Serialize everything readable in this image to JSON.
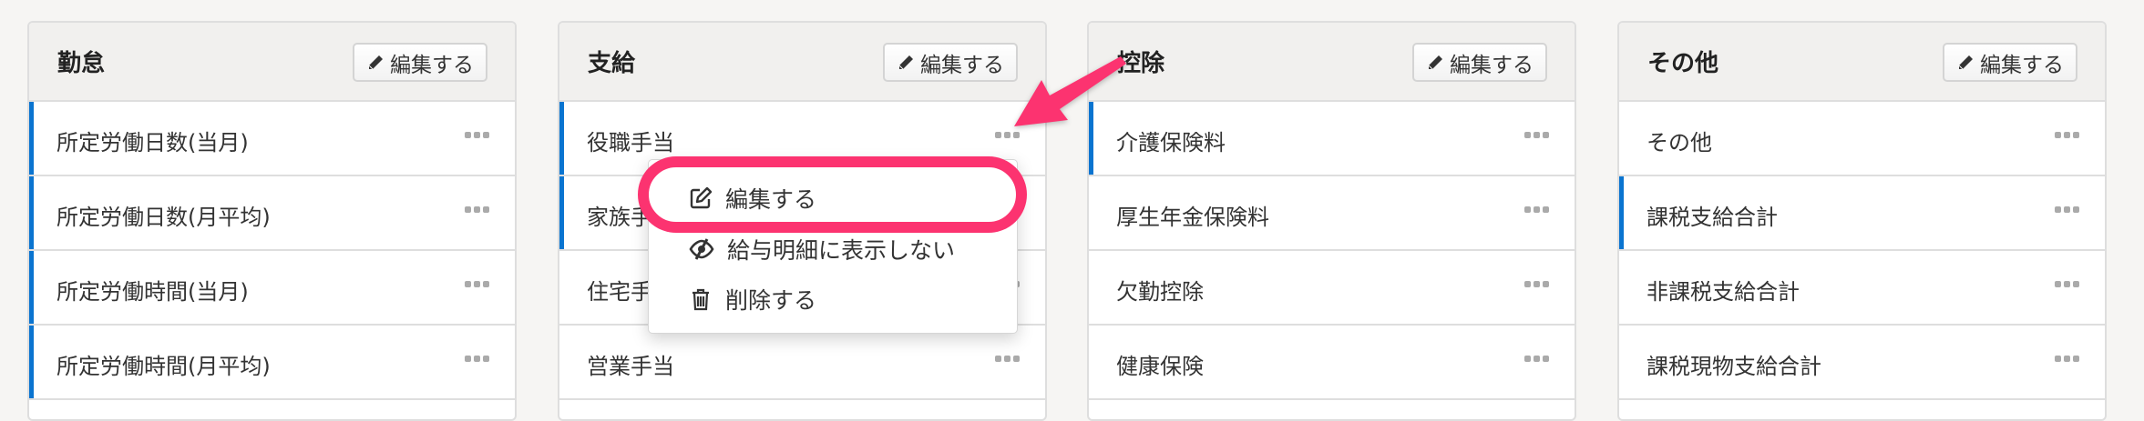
{
  "columns": [
    {
      "title": "勤怠",
      "edit_label": "編集する",
      "items": [
        {
          "label": "所定労働日数(当月)",
          "marked": true
        },
        {
          "label": "所定労働日数(月平均)",
          "marked": true
        },
        {
          "label": "所定労働時間(当月)",
          "marked": true
        },
        {
          "label": "所定労働時間(月平均)",
          "marked": true
        }
      ]
    },
    {
      "title": "支給",
      "edit_label": "編集する",
      "items": [
        {
          "label": "役職手当",
          "marked": true
        },
        {
          "label": "家族手当",
          "marked": true
        },
        {
          "label": "住宅手当",
          "marked": false
        },
        {
          "label": "営業手当",
          "marked": false
        }
      ]
    },
    {
      "title": "控除",
      "edit_label": "編集する",
      "items": [
        {
          "label": "介護保険料",
          "marked": true
        },
        {
          "label": "厚生年金保険料",
          "marked": false
        },
        {
          "label": "欠勤控除",
          "marked": false
        },
        {
          "label": "健康保険",
          "marked": false
        }
      ]
    },
    {
      "title": "その他",
      "edit_label": "編集する",
      "items": [
        {
          "label": "その他",
          "marked": false
        },
        {
          "label": "課税支給合計",
          "marked": true
        },
        {
          "label": "非課税支給合計",
          "marked": false
        },
        {
          "label": "課税現物支給合計",
          "marked": false
        }
      ]
    }
  ],
  "context_menu": {
    "items": [
      {
        "label": "編集する",
        "icon": "edit-icon"
      },
      {
        "label": "給与明細に表示しない",
        "icon": "eye-slash-icon"
      },
      {
        "label": "削除する",
        "icon": "trash-icon"
      }
    ]
  },
  "colors": {
    "accent": "#0a74d0",
    "annotation": "#fc3370"
  }
}
